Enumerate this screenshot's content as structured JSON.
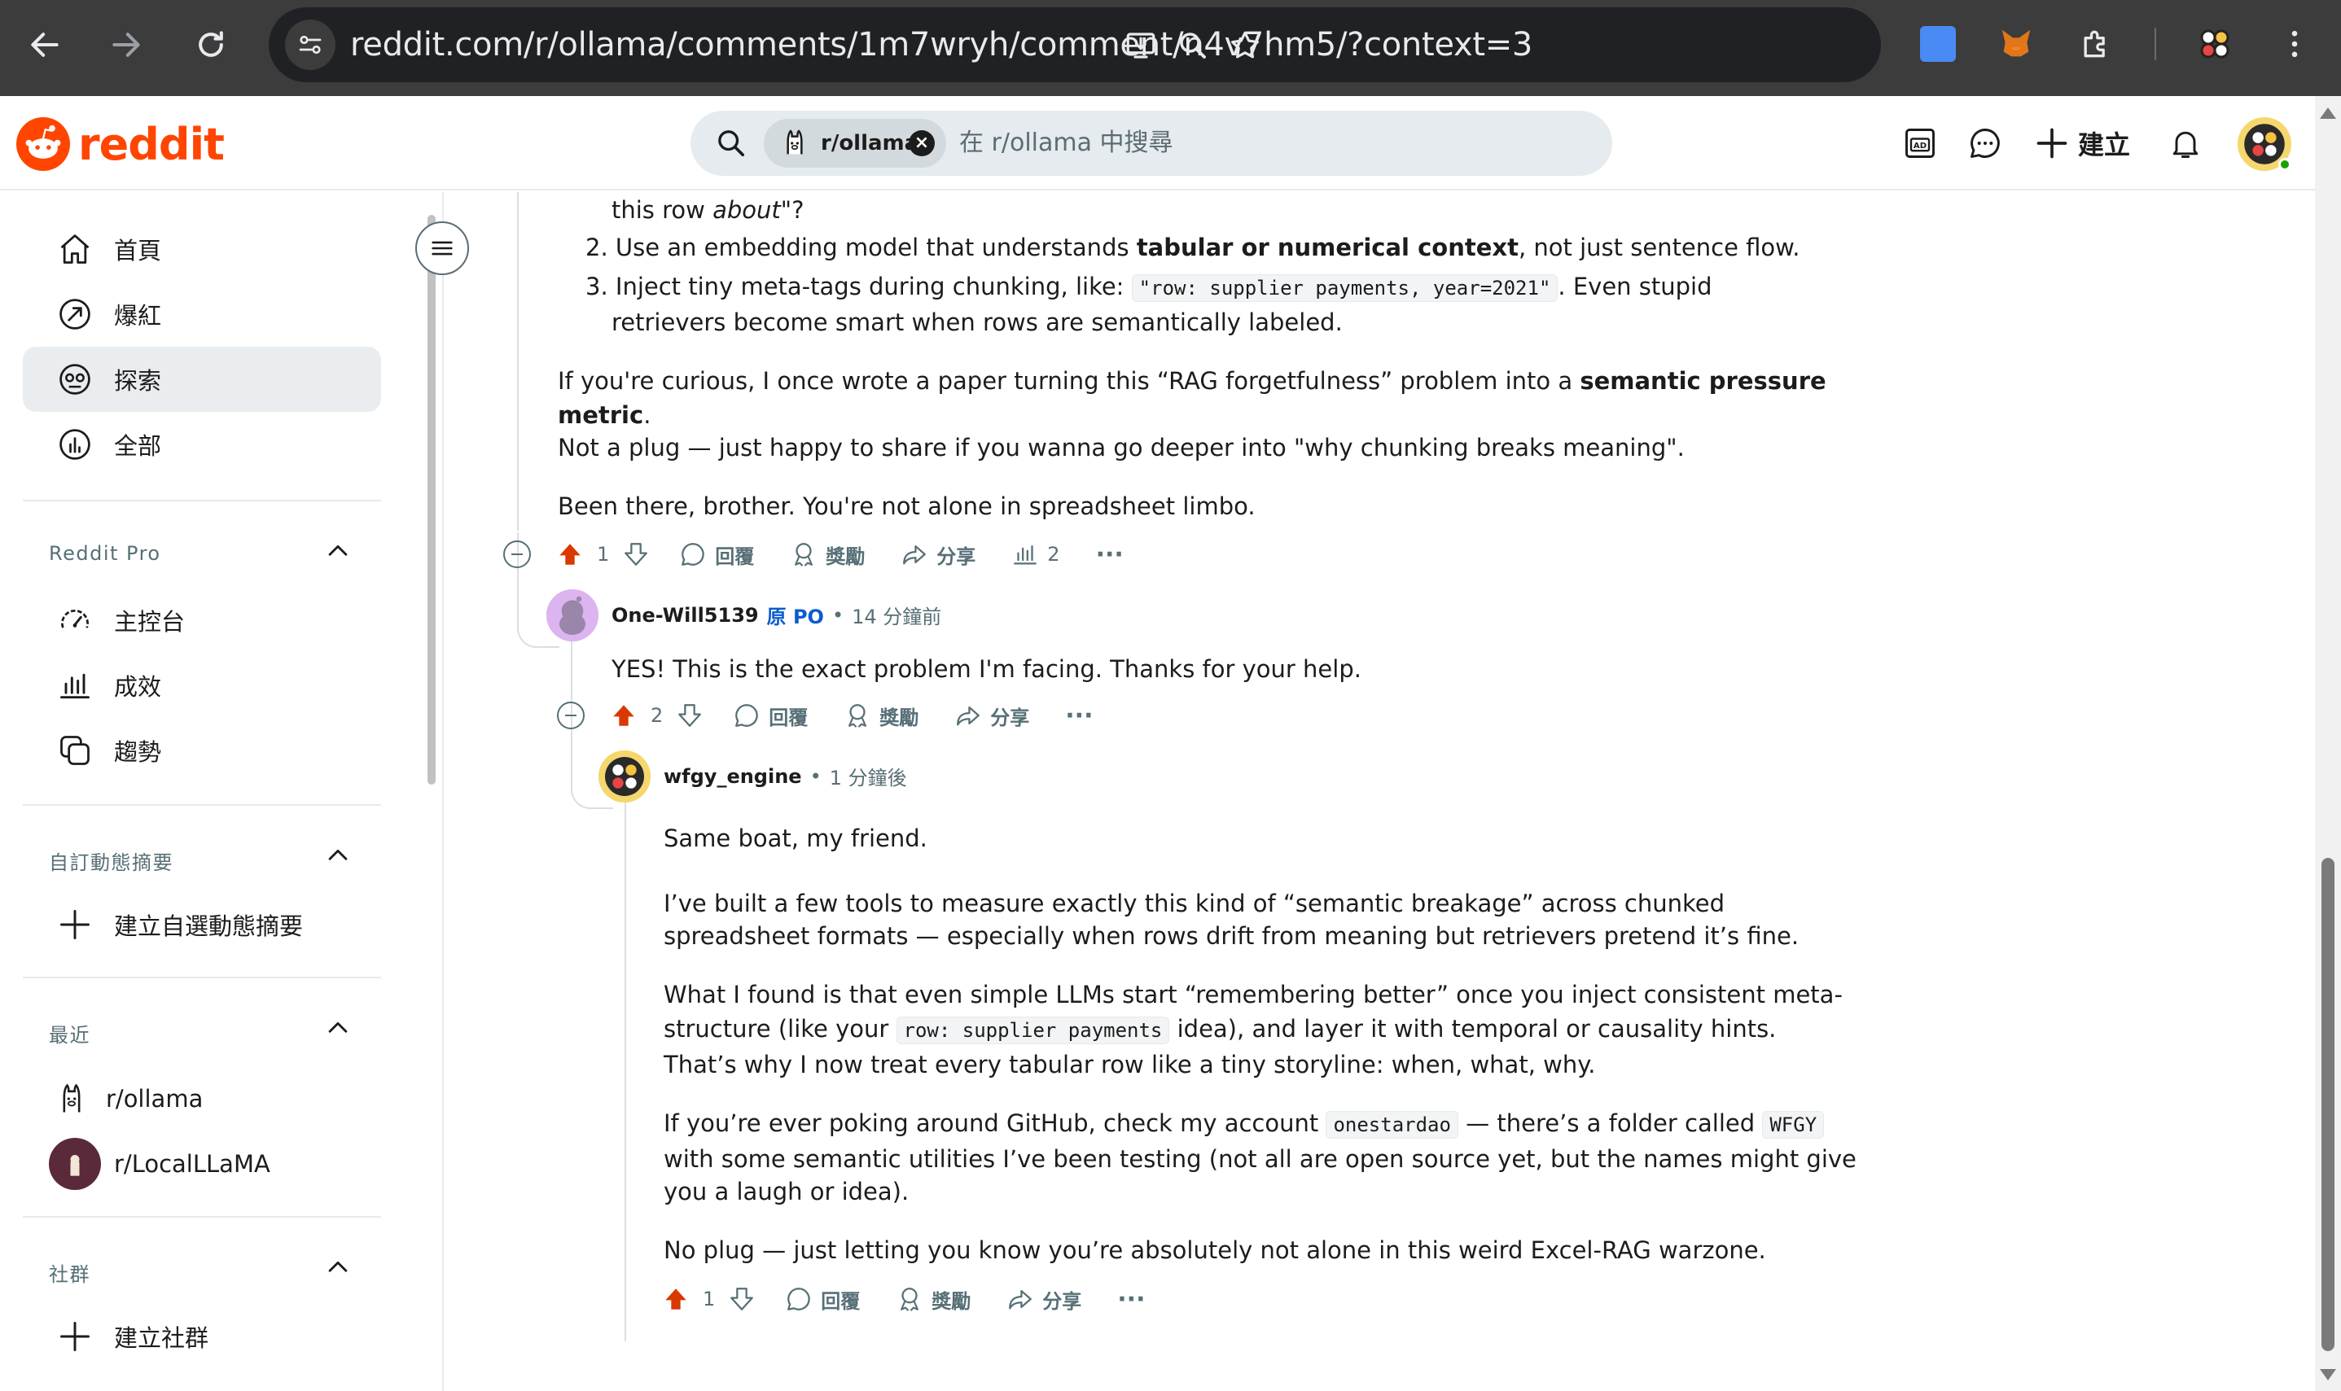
{
  "browser": {
    "url": "reddit.com/r/ollama/comments/1m7wryh/comment/n4v7hm5/?context=3"
  },
  "header": {
    "logo_text": "reddit",
    "search": {
      "chip_label": "r/ollama",
      "placeholder": "在 r/ollama 中搜尋"
    },
    "create_label": "建立"
  },
  "sidebar": {
    "main_items": [
      {
        "label": "首頁",
        "icon": "home-icon"
      },
      {
        "label": "爆紅",
        "icon": "popular-icon"
      },
      {
        "label": "探索",
        "icon": "explore-icon"
      },
      {
        "label": "全部",
        "icon": "all-icon"
      }
    ],
    "pro": {
      "heading": "Reddit Pro",
      "items": [
        {
          "label": "主控台",
          "icon": "dashboard-icon"
        },
        {
          "label": "成效",
          "icon": "stats-icon"
        },
        {
          "label": "趨勢",
          "icon": "trends-icon"
        }
      ]
    },
    "custom_feeds": {
      "heading": "自訂動態摘要",
      "create_label": "建立自選動態摘要"
    },
    "recent": {
      "heading": "最近",
      "items": [
        {
          "label": "r/ollama"
        },
        {
          "label": "r/LocalLLaMA"
        }
      ]
    },
    "communities": {
      "heading": "社群",
      "create_label": "建立社群"
    }
  },
  "thread": {
    "parent_comment": {
      "line_top_tail": "this row ",
      "line_top_italic": "about",
      "line_top_end": "\"?",
      "list": [
        {
          "num": "2.",
          "pre": "Use an embedding model that understands ",
          "bold": "tabular or numerical context",
          "post": ", not just sentence flow."
        },
        {
          "num": "3.",
          "pre": "Inject tiny meta-tags during chunking, like: ",
          "code": "\"row: supplier payments, year=2021\"",
          "post": ". Even stupid",
          "line2": "retrievers become smart when rows are semantically labeled."
        }
      ],
      "para1_pre": "If you're curious, I once wrote a paper turning this “RAG forgetfulness” problem into a ",
      "para1_bold_a": "semantic pressure",
      "para1_bold_b": "metric",
      "para1_end": ".",
      "para1_line3": "Not a plug — just happy to share if you wanna go deeper into \"why chunking breaks meaning\".",
      "para2": "Been there, brother. You're not alone in spreadsheet limbo.",
      "votes": "1",
      "reply": "回覆",
      "award": "獎勵",
      "share": "分享",
      "insights": "2",
      "more": "···"
    },
    "reply1": {
      "author": "One-Will5139",
      "op_badge": "原 PO",
      "time": "14 分鐘前",
      "body": "YES! This is the exact problem I'm facing. Thanks for your help.",
      "votes": "2",
      "reply": "回覆",
      "award": "獎勵",
      "share": "分享",
      "more": "···"
    },
    "reply2": {
      "author": "wfgy_engine",
      "time": "1 分鐘後",
      "p1": "Same boat, my friend.",
      "p2_l1": "I’ve built a few tools to measure exactly this kind of “semantic breakage” across chunked",
      "p2_l2": "spreadsheet formats — especially when rows drift from meaning but retrievers pretend it’s fine.",
      "p3_l1": "What I found is that even simple LLMs start “remembering better” once you inject consistent meta-",
      "p3_l2_pre": "structure (like your ",
      "p3_l2_code": "row: supplier payments",
      "p3_l2_post": " idea), and layer it with temporal or causality hints.",
      "p3_l3": "That’s why I now treat every tabular row like a tiny storyline: when, what, why.",
      "p4_l1_pre": "If you’re ever poking around GitHub, check my account ",
      "p4_l1_code1": "onestardao",
      "p4_l1_mid": " — there’s a folder called ",
      "p4_l1_code2": "WFGY",
      "p4_l2": "with some semantic utilities I’ve been testing (not all are open source yet, but the names might give",
      "p4_l3": "you a laugh or idea).",
      "p5": "No plug — just letting you know you’re absolutely not alone in this weird Excel-RAG warzone.",
      "votes": "1",
      "reply": "回覆",
      "award": "獎勵",
      "share": "分享",
      "more": "···"
    }
  },
  "colors": {
    "upvote": "#d93900",
    "brand": "#ff4500",
    "op_blue": "#0a5ccf",
    "meta_gray": "#576f76"
  }
}
